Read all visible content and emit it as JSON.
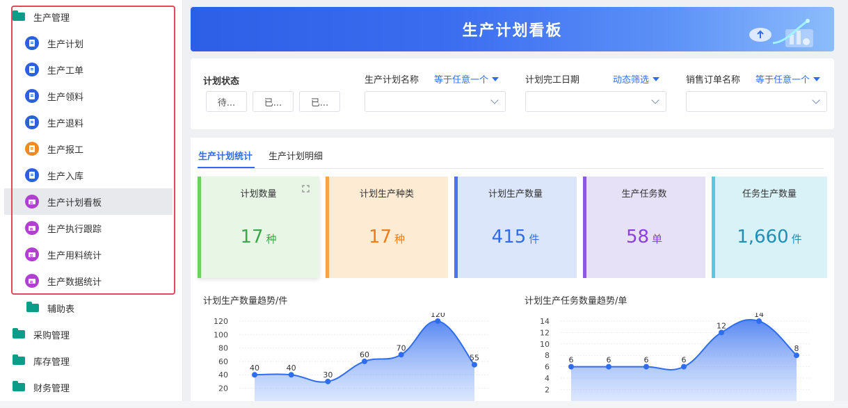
{
  "sidebar": {
    "group_production": "生产管理",
    "items": [
      {
        "label": "生产计划",
        "icon": "document-icon",
        "color": "#2b62dc"
      },
      {
        "label": "生产工单",
        "icon": "document-icon",
        "color": "#2b62dc"
      },
      {
        "label": "生产领料",
        "icon": "document-icon",
        "color": "#2b62dc"
      },
      {
        "label": "生产退料",
        "icon": "document-icon",
        "color": "#2b62dc"
      },
      {
        "label": "生产报工",
        "icon": "clipboard-icon",
        "color": "#f08a24"
      },
      {
        "label": "生产入库",
        "icon": "document-icon",
        "color": "#2b62dc"
      },
      {
        "label": "生产计划看板",
        "icon": "dashboard-icon",
        "color": "#b13fd1"
      },
      {
        "label": "生产执行跟踪",
        "icon": "dashboard-icon",
        "color": "#b13fd1"
      },
      {
        "label": "生产用料统计",
        "icon": "dashboard-icon",
        "color": "#b13fd1"
      },
      {
        "label": "生产数据统计",
        "icon": "dashboard-icon",
        "color": "#b13fd1"
      }
    ],
    "subfolder_aux": "辅助表",
    "group_purchase": "采购管理",
    "group_inventory": "库存管理",
    "group_finance": "财务管理"
  },
  "banner": {
    "title": "生产计划看板"
  },
  "filters": {
    "plan_status_label": "计划状态",
    "status_buttons": [
      "待...",
      "已...",
      "已..."
    ],
    "plan_name_label": "生产计划名称",
    "plan_name_mode": "等于任意一个",
    "plan_date_label": "计划完工日期",
    "plan_date_mode": "动态筛选",
    "sales_order_label": "销售订单名称",
    "sales_order_mode": "等于任意一个"
  },
  "tabs": [
    "生产计划统计",
    "生产计划明细"
  ],
  "kpis": [
    {
      "title": "计划数量",
      "value": "17",
      "unit": "种",
      "color": "#3aa84a",
      "bg": "#e7f5e4",
      "bar": "#6fcf62"
    },
    {
      "title": "计划生产种类",
      "value": "17",
      "unit": "种",
      "color": "#f07d1a",
      "bg": "#fdebd3",
      "bar": "#f5a54a"
    },
    {
      "title": "计划生产数量",
      "value": "415",
      "unit": "件",
      "color": "#2f6df0",
      "bg": "#dbe6fb",
      "bar": "#3f78ee"
    },
    {
      "title": "生产任务数",
      "value": "58",
      "unit": "单",
      "color": "#8a3fe0",
      "bg": "#e7e1f8",
      "bar": "#8f5ad8"
    },
    {
      "title": "任务生产数量",
      "value": "1,660",
      "unit": "件",
      "color": "#1f8fb3",
      "bg": "#d8f2f7",
      "bar": "#5bc8dd"
    }
  ],
  "chart_data": [
    {
      "type": "area",
      "title": "计划生产数量趋势/件",
      "y_ticks": [
        "120",
        "100",
        "80",
        "60",
        "40",
        "20"
      ],
      "ylim": [
        0,
        120
      ],
      "values": [
        40,
        40,
        30,
        60,
        70,
        120,
        55
      ],
      "color": "#2f6df0"
    },
    {
      "type": "area",
      "title": "计划生产任务数量趋势/单",
      "y_ticks": [
        "14",
        "12",
        "10",
        "8",
        "6",
        "4",
        "2"
      ],
      "ylim": [
        0,
        14
      ],
      "values": [
        6,
        6,
        6,
        6,
        12,
        14,
        8
      ],
      "color": "#2f6df0"
    }
  ]
}
